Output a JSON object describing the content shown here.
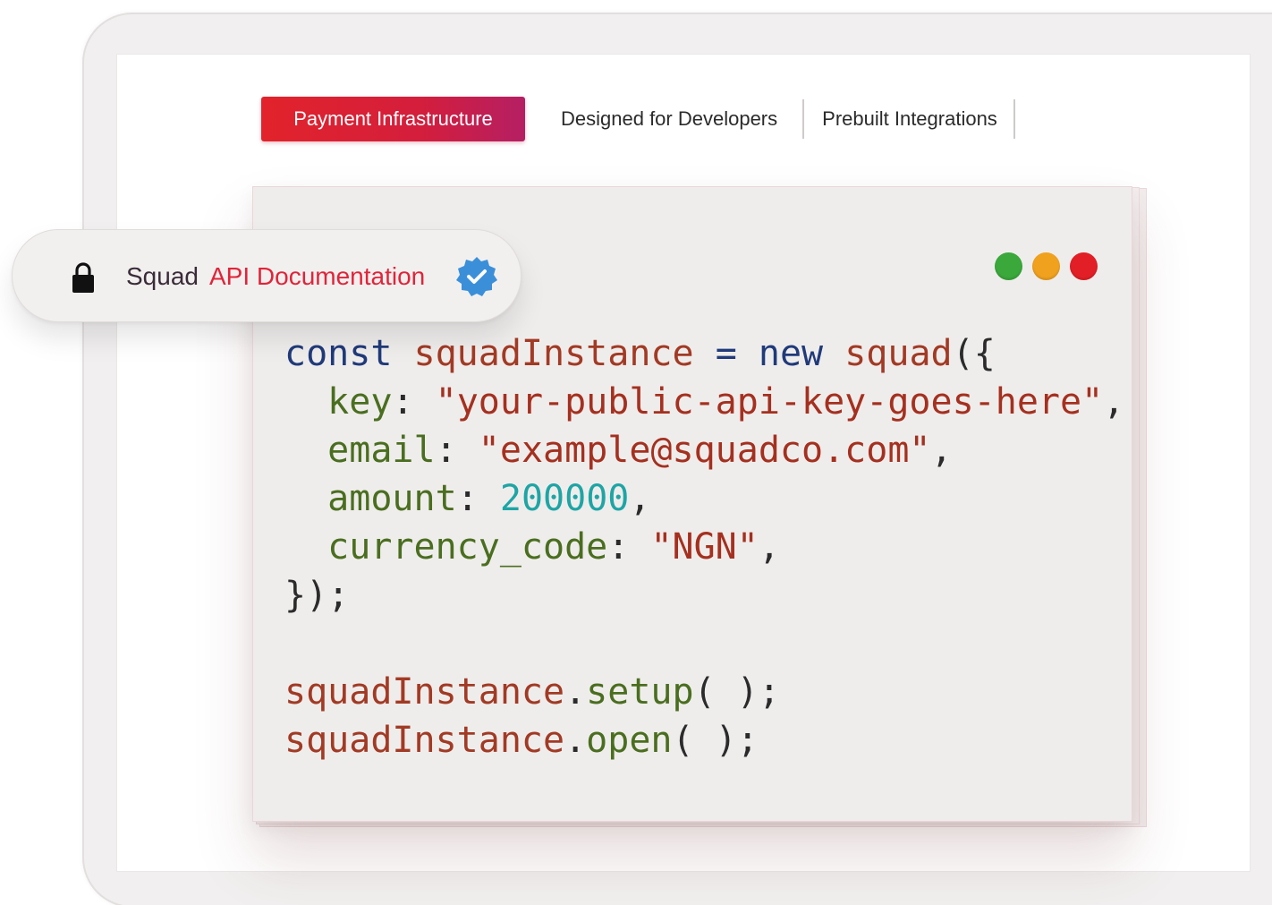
{
  "tabs": [
    {
      "label": "Payment Infrastructure",
      "active": true
    },
    {
      "label": "Designed for Developers",
      "active": false
    },
    {
      "label": "Prebuilt Integrations",
      "active": false
    }
  ],
  "address_bar": {
    "lock_icon": "lock-icon",
    "brand": "Squad",
    "link": "API Documentation",
    "badge_icon": "verified-badge-icon"
  },
  "window_controls": [
    {
      "name": "green-dot",
      "color": "#3aa83a"
    },
    {
      "name": "yellow-dot",
      "color": "#f0a11e"
    },
    {
      "name": "red-dot",
      "color": "#e21f26"
    }
  ],
  "code": {
    "line1": {
      "kw1": "const",
      "var": "squadInstance",
      "op": "=",
      "kw2": "new",
      "fn": "squad",
      "open": "({"
    },
    "line2": {
      "prop": "key",
      "colon": ":",
      "value": "\"your-public-api-key-goes-here\"",
      "comma": ","
    },
    "line3": {
      "prop": "email",
      "colon": ":",
      "value": "\"example@squadco.com\"",
      "comma": ","
    },
    "line4": {
      "prop": "amount",
      "colon": ":",
      "value": "200000",
      "comma": ","
    },
    "line5": {
      "prop": "currency_code",
      "colon": ":",
      "value": "\"NGN\"",
      "comma": ","
    },
    "line6": {
      "close": "});"
    },
    "line8": {
      "obj": "squadInstance",
      "dot": ".",
      "method": "setup",
      "call": "( );"
    },
    "line9": {
      "obj": "squadInstance",
      "dot": ".",
      "method": "open",
      "call": "( );"
    }
  },
  "colors": {
    "accent_start": "#e2232b",
    "accent_end": "#b51f63",
    "link": "#e0243a",
    "verified": "#3b8fd9"
  }
}
